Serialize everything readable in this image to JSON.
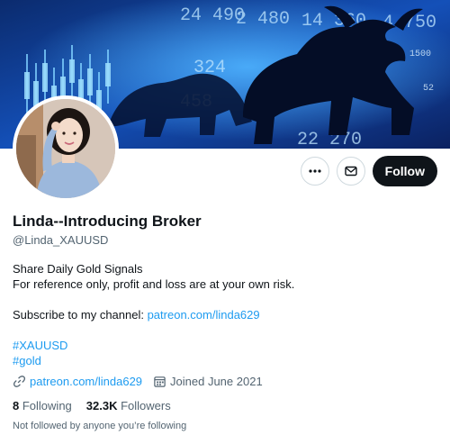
{
  "profile": {
    "name": "Linda--Introducing Broker",
    "handle": "@Linda_XAUUSD",
    "follow_label": "Follow",
    "bio_line1": "Share Daily Gold Signals",
    "bio_line2": "For reference only, profit and loss are at your own risk.",
    "subscribe_text": "Subscribe to my channel: ",
    "subscribe_link": "patreon.com/linda629",
    "hashtag1": "#XAUUSD",
    "hashtag2": "#gold",
    "website": "patreon.com/linda629",
    "joined": "Joined June 2021",
    "following_count": "8",
    "following_label": "Following",
    "followers_count": "32.3K",
    "followers_label": "Followers",
    "not_followed": "Not followed by anyone you’re following"
  },
  "banner": {
    "numbers": [
      "24 490",
      "2 480",
      "4 750",
      "1500",
      "14 360",
      "52",
      "324",
      "22 270",
      "458"
    ]
  },
  "colors": {
    "accent": "#1d9bf0",
    "follow_bg": "#0f1419",
    "banner_bg": "#0a1230",
    "banner_glow": "#3aa0ff"
  },
  "icons": {
    "more": "more-dots-icon",
    "message": "envelope-icon",
    "link": "link-icon",
    "calendar": "calendar-icon"
  }
}
